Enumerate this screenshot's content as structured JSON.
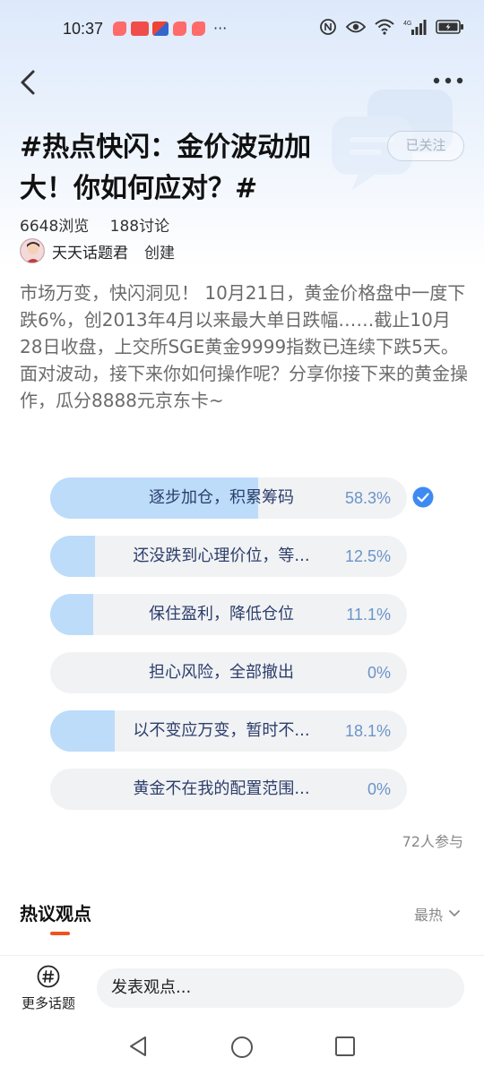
{
  "status_bar": {
    "time": "10:37",
    "more": "···",
    "network": "4G"
  },
  "nav": {
    "back_icon": "chevron-left-icon",
    "more_icon": "more-dots-icon"
  },
  "topic": {
    "title": "#热点快闪：金价波动加大！你如何应对？#",
    "follow_label": "已关注",
    "views": "6648浏览",
    "discussions": "188讨论",
    "creator_name": "天天话题君",
    "creator_role": "创建",
    "description": "市场万变，快闪洞见！ 10月21日，黄金价格盘中一度下跌6%，创2013年4月以来最大单日跌幅……截止10月28日收盘，上交所SGE黄金9999指数已连续下跌5天。 面对波动，接下来你如何操作呢？分享你接下来的黄金操作，瓜分8888元京东卡~"
  },
  "poll": {
    "options": [
      {
        "label": "逐步加仓，积累筹码",
        "percent": "58.3%",
        "fraction": 0.583,
        "selected": true
      },
      {
        "label": "还没跌到心理价位，等...",
        "percent": "12.5%",
        "fraction": 0.125,
        "selected": false
      },
      {
        "label": "保住盈利，降低仓位",
        "percent": "11.1%",
        "fraction": 0.111,
        "selected": false
      },
      {
        "label": "担心风险，全部撤出",
        "percent": "0%",
        "fraction": 0.0,
        "selected": false
      },
      {
        "label": "以不变应万变，暂时不...",
        "percent": "18.1%",
        "fraction": 0.181,
        "selected": false
      },
      {
        "label": "黄金不在我的配置范围...",
        "percent": "0%",
        "fraction": 0.0,
        "selected": false
      }
    ],
    "participants": "72人参与"
  },
  "hot": {
    "title": "热议观点",
    "sort_label": "最热"
  },
  "bottom": {
    "more_topics_label": "更多话题",
    "comment_placeholder": "发表观点..."
  },
  "colors": {
    "accent": "#f0521e",
    "poll_fill": "#bcdcfa",
    "poll_track": "#f1f2f4",
    "check_blue": "#3d8bf2"
  }
}
